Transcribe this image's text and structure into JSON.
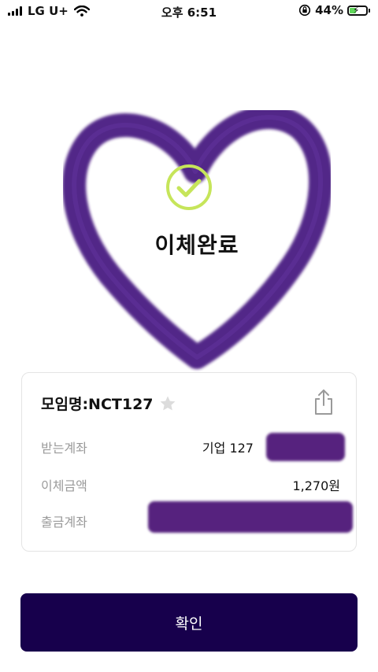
{
  "status_bar": {
    "carrier": "LG U+",
    "time": "오후 6:51",
    "battery_percent_text": "44%",
    "battery_level": 0.44
  },
  "result": {
    "title": "이체완료"
  },
  "card": {
    "group_name": "모임명:NCT127",
    "rows": [
      {
        "label": "받는계좌",
        "value": "기업 127"
      },
      {
        "label": "이체금액",
        "value": "1,270원"
      },
      {
        "label": "출금계좌",
        "value": ""
      }
    ]
  },
  "confirm_button": {
    "label": "확인"
  },
  "colors": {
    "heart": "#4a1a82",
    "check": "#c6e55a",
    "button": "#17004c",
    "redaction": "#56227e"
  },
  "icons": {
    "wifi": "wifi-icon",
    "orientation_lock": "orientation-lock-icon",
    "favorite": "star-icon",
    "share": "share-icon",
    "checkmark": "check-circle-icon"
  }
}
